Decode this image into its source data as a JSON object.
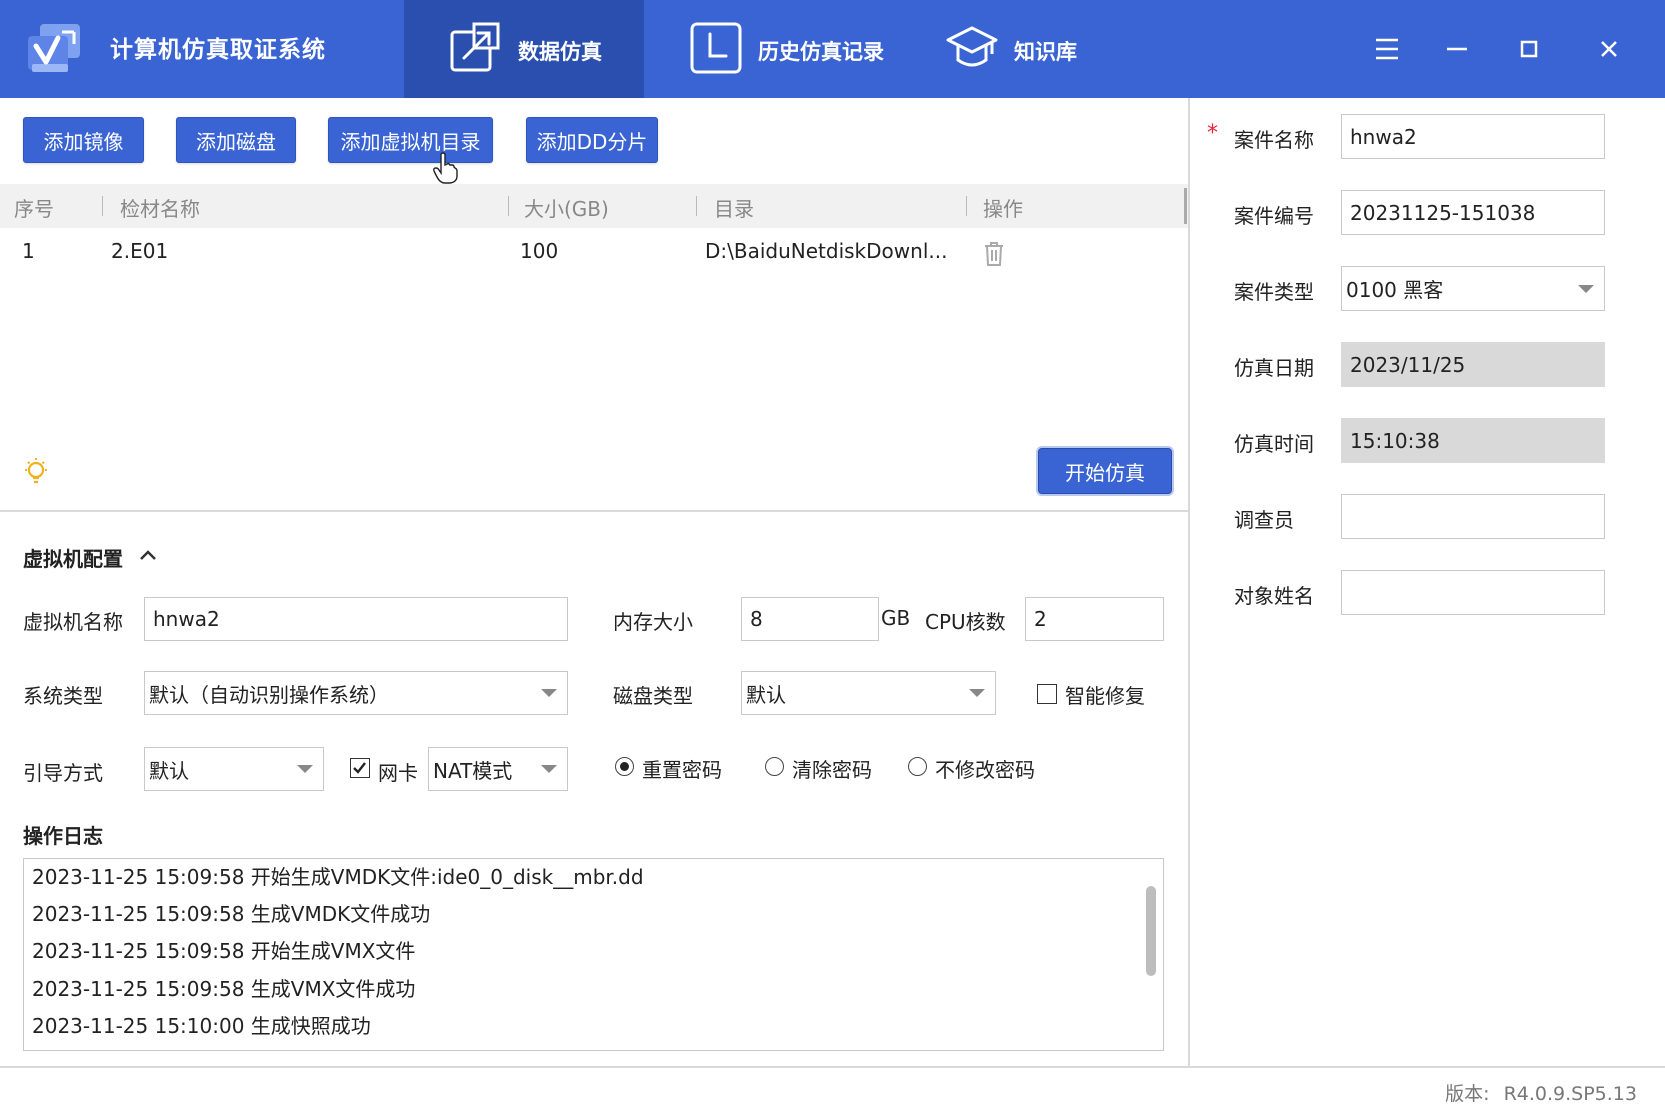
{
  "app": {
    "title": "计算机仿真取证系统"
  },
  "nav": {
    "tabs": [
      {
        "label": "数据仿真",
        "icon": "open-external-icon",
        "active": true
      },
      {
        "label": "历史仿真记录",
        "icon": "clock-icon",
        "active": false
      },
      {
        "label": "知识库",
        "icon": "graduation-cap-icon",
        "active": false
      }
    ]
  },
  "window_controls": [
    "menu-icon",
    "minimize-icon",
    "maximize-icon",
    "close-icon"
  ],
  "toolbar": {
    "add_image": "添加镜像",
    "add_disk": "添加磁盘",
    "add_vm_dir": "添加虚拟机目录",
    "add_dd": "添加DD分片"
  },
  "table": {
    "columns": [
      "序号",
      "检材名称",
      "大小(GB)",
      "目录",
      "操作"
    ],
    "rows": [
      {
        "index": "1",
        "name": "2.E01",
        "size": "100",
        "path": "D:\\BaiduNetdiskDownl..."
      }
    ]
  },
  "start_button": "开始仿真",
  "vm_config": {
    "title": "虚拟机配置",
    "vm_name_label": "虚拟机名称",
    "vm_name_value": "hnwa2",
    "memory_label": "内存大小",
    "memory_value": "8",
    "memory_unit": "GB",
    "cpu_label": "CPU核数",
    "cpu_value": "2",
    "os_type_label": "系统类型",
    "os_type_value": "默认（自动识别操作系统）",
    "disk_type_label": "磁盘类型",
    "disk_type_value": "默认",
    "smart_repair_label": "智能修复",
    "smart_repair_checked": false,
    "boot_label": "引导方式",
    "boot_value": "默认",
    "nic_label": "网卡",
    "nic_checked": true,
    "nic_mode_value": "NAT模式",
    "password_options": [
      {
        "label": "重置密码",
        "selected": true
      },
      {
        "label": "清除密码",
        "selected": false
      },
      {
        "label": "不修改密码",
        "selected": false
      }
    ]
  },
  "log": {
    "title": "操作日志",
    "lines": [
      "2023-11-25 15:09:58 开始生成VMDK文件:ide0_0_disk__mbr.dd",
      "2023-11-25 15:09:58 生成VMDK文件成功",
      "2023-11-25 15:09:58 开始生成VMX文件",
      "2023-11-25 15:09:58 生成VMX文件成功",
      "2023-11-25 15:10:00 生成快照成功"
    ]
  },
  "case": {
    "required_mark": "*",
    "name_label": "案件名称",
    "name_value": "hnwa2",
    "number_label": "案件编号",
    "number_value": "20231125-151038",
    "type_label": "案件类型",
    "type_value": "0100 黑客",
    "date_label": "仿真日期",
    "date_value": "2023/11/25",
    "time_label": "仿真时间",
    "time_value": "15:10:38",
    "investigator_label": "调查员",
    "investigator_value": "",
    "subject_label": "对象姓名",
    "subject_value": ""
  },
  "status": {
    "version_label": "版本:",
    "version_value": "R4.0.9.SP5.13"
  },
  "colors": {
    "brand": "#3a64d4",
    "active_tab": "#2b4fae",
    "required": "#e23333"
  }
}
